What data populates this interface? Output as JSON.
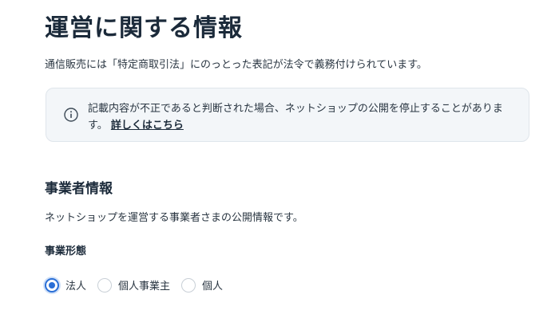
{
  "page": {
    "title": "運営に関する情報",
    "intro": "通信販売には「特定商取引法」にのっとった表記が法令で義務付けられています。"
  },
  "notice": {
    "icon": "info-icon",
    "text": "記載内容が不正であると判断された場合、ネットショップの公開を停止することがあります。",
    "link_label": "詳しくはこちら"
  },
  "business_section": {
    "title": "事業者情報",
    "description": "ネットショップを運営する事業者さまの公開情報です。",
    "business_type": {
      "label": "事業形態",
      "options": [
        {
          "label": "法人",
          "selected": true
        },
        {
          "label": "個人事業主",
          "selected": false
        },
        {
          "label": "個人",
          "selected": false
        }
      ],
      "accent_color": "#2b6fd6"
    }
  }
}
